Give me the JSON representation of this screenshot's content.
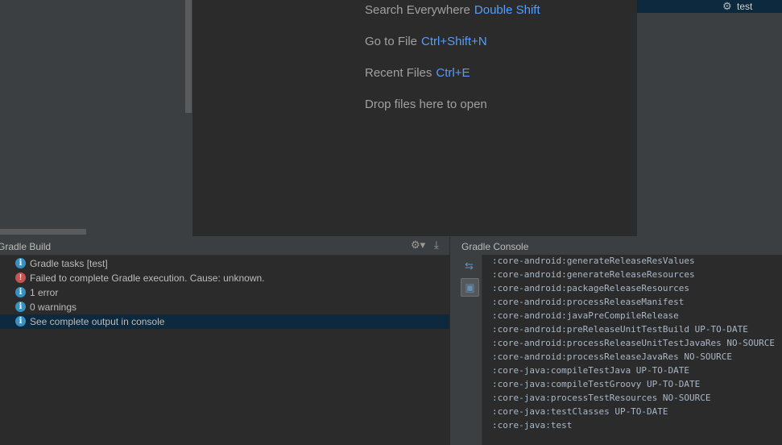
{
  "run_config": {
    "label": "test"
  },
  "welcome_hints": [
    {
      "text": "Search Everywhere",
      "shortcut": "Double Shift"
    },
    {
      "text": "Go to File",
      "shortcut": "Ctrl+Shift+N"
    },
    {
      "text": "Recent Files",
      "shortcut": "Ctrl+E"
    },
    {
      "text": "Drop files here to open",
      "shortcut": ""
    }
  ],
  "gradle_build": {
    "title": "Gradle Build",
    "items": [
      {
        "icon": "info-icon",
        "text": "Gradle tasks [test]"
      },
      {
        "icon": "error-icon",
        "text": "Failed to complete Gradle execution. Cause: unknown."
      },
      {
        "icon": "info-icon",
        "text": "1 error"
      },
      {
        "icon": "info-icon",
        "text": "0 warnings"
      },
      {
        "icon": "info-icon",
        "text": "See complete output in console"
      }
    ]
  },
  "gradle_console": {
    "title": "Gradle Console",
    "lines": [
      ":core-android:generateReleaseResValues",
      ":core-android:generateReleaseResources",
      ":core-android:packageReleaseResources",
      ":core-android:processReleaseManifest",
      ":core-android:javaPreCompileRelease",
      ":core-android:preReleaseUnitTestBuild UP-TO-DATE",
      ":core-android:processReleaseUnitTestJavaRes NO-SOURCE",
      ":core-android:processReleaseJavaRes NO-SOURCE",
      ":core-java:compileTestJava UP-TO-DATE",
      ":core-java:compileTestGroovy UP-TO-DATE",
      ":core-java:processTestResources NO-SOURCE",
      ":core-java:testClasses UP-TO-DATE",
      ":core-java:test"
    ]
  }
}
